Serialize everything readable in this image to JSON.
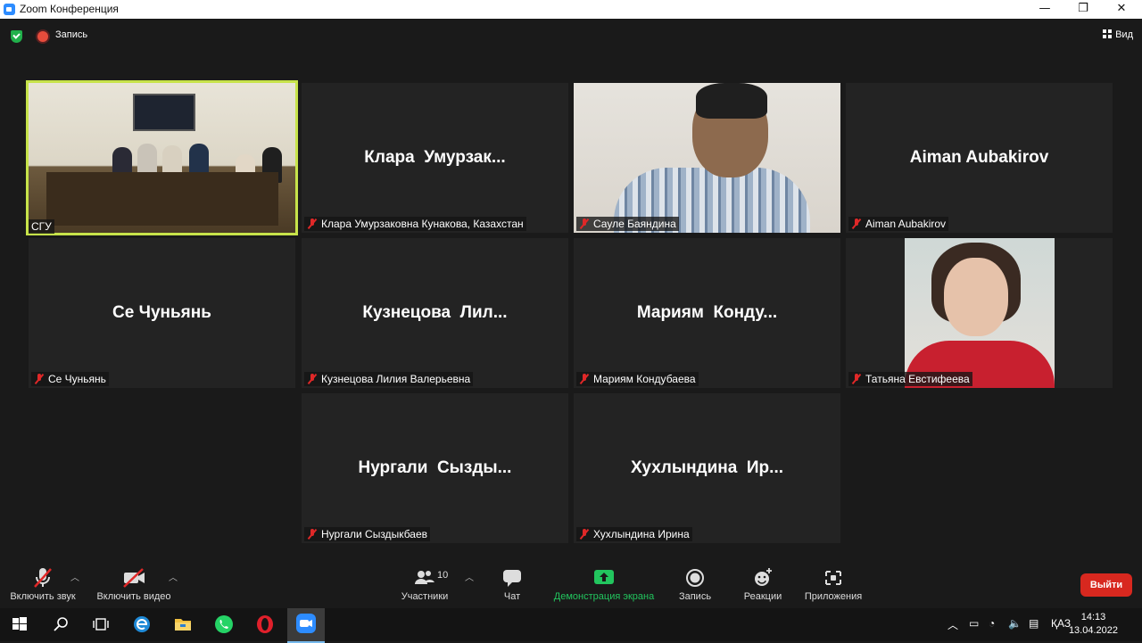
{
  "window": {
    "title": "Zoom Конференция",
    "controls": [
      "—",
      "❐",
      "✕"
    ]
  },
  "topbar": {
    "recording_label": "Запись",
    "view_label": "Вид"
  },
  "tiles": [
    {
      "display_name": "",
      "label": "СГУ"
    },
    {
      "display_name": "Клара  Умурзак...",
      "label": "Клара Умурзаковна Кунакова, Казахстан"
    },
    {
      "display_name": "",
      "label": "Сауле Баяндина"
    },
    {
      "display_name": "Aiman Aubakirov",
      "label": "Aiman Aubakirov"
    },
    {
      "display_name": "Се Чуньянь",
      "label": "Се Чуньянь"
    },
    {
      "display_name": "Кузнецова  Лил...",
      "label": "Кузнецова Лилия Валерьевна"
    },
    {
      "display_name": "Мариям  Конду...",
      "label": "Мариям Кондубаева"
    },
    {
      "display_name": "",
      "label": "Татьяна Евстифеева"
    },
    {
      "display_name": "Нургали  Сызды...",
      "label": "Нургали Сыздыкбаев"
    },
    {
      "display_name": "Хухлындина  Ир...",
      "label": "Хухлындина Ирина"
    }
  ],
  "toolbar": {
    "audio_label": "Включить звук",
    "video_label": "Включить видео",
    "participants_label": "Участники",
    "participants_count": "10",
    "chat_label": "Чат",
    "share_label": "Демонстрация экрана",
    "record_label": "Запись",
    "reactions_label": "Реакции",
    "apps_label": "Приложения",
    "leave_label": "Выйти"
  },
  "taskbar": {
    "language": "ҚАЗ",
    "time": "14:13",
    "date": "13.04.2022"
  },
  "colors": {
    "active_speaker": "#c7e34a",
    "share_green": "#22c55e",
    "leave_red": "#d8281f",
    "mute_red": "#e02828"
  }
}
